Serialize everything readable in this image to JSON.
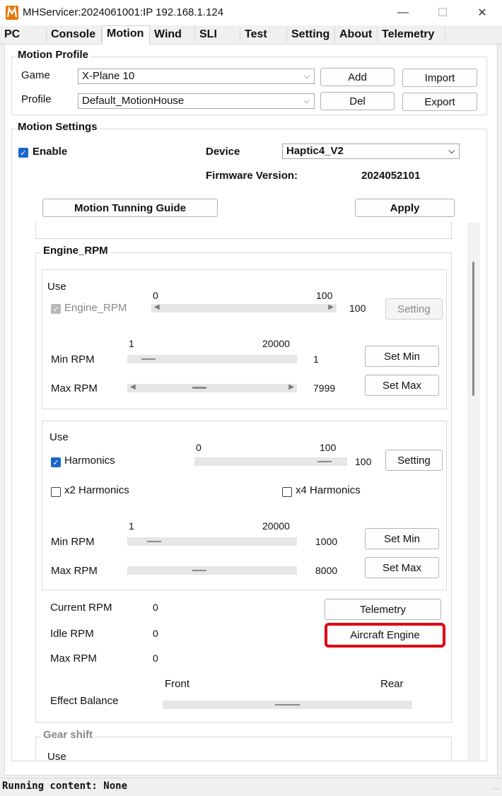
{
  "window": {
    "title": "MHServicer:2024061001:IP 192.168.1.124",
    "minimize_glyph": "—",
    "maximize_glyph": "☐",
    "close_glyph": "✕"
  },
  "tabs": [
    "PC",
    "Console",
    "Motion",
    "Wind",
    "SLI",
    "Test",
    "Setting",
    "About",
    "Telemetry"
  ],
  "active_tab": "Motion",
  "motion_profile": {
    "title": "Motion Profile",
    "game_label": "Game",
    "game_value": "X-Plane 10",
    "profile_label": "Profile",
    "profile_value": "Default_MotionHouse",
    "add_label": "Add",
    "import_label": "Import",
    "del_label": "Del",
    "export_label": "Export"
  },
  "motion_settings": {
    "title": "Motion Settings",
    "enable_label": "Enable",
    "enable_checked": true,
    "device_label": "Device",
    "device_value": "Haptic4_V2",
    "firmware_label": "Firmware Version:",
    "firmware_value": "2024052101",
    "guide_button": "Motion Tunning Guide",
    "apply_button": "Apply"
  },
  "engine_rpm": {
    "title": "Engine_RPM",
    "engine_box": {
      "use_label": "Use",
      "checkbox_label": "Engine_RPM",
      "scale_min": "0",
      "scale_max": "100",
      "value": "100",
      "level_fraction": 1.0,
      "setting_button": "Setting",
      "rpm_scale_min": "1",
      "rpm_scale_max": "20000",
      "min_rpm_label": "Min RPM",
      "min_rpm_value": "1",
      "set_min_button": "Set Min",
      "max_rpm_label": "Max RPM",
      "max_rpm_value": "7999",
      "set_max_button": "Set Max"
    },
    "harmonics_box": {
      "use_label": "Use",
      "checkbox_label": "Harmonics",
      "harmonics_checked": true,
      "scale_min": "0",
      "scale_max": "100",
      "value": "100",
      "setting_button": "Setting",
      "x2_label": "x2 Harmonics",
      "x4_label": "x4 Harmonics",
      "rpm_scale_min": "1",
      "rpm_scale_max": "20000",
      "min_rpm_label": "Min RPM",
      "min_rpm_value": "1000",
      "set_min_button": "Set Min",
      "max_rpm_label": "Max RPM",
      "max_rpm_value": "8000",
      "set_max_button": "Set Max"
    },
    "current_rpm_label": "Current RPM",
    "current_rpm_value": "0",
    "idle_rpm_label": "Idle RPM",
    "idle_rpm_value": "0",
    "max_rpm_label": "Max RPM",
    "max_rpm_value": "0",
    "telemetry_button": "Telemetry",
    "aircraft_engine_button": "Aircraft Engine",
    "front_label": "Front",
    "rear_label": "Rear",
    "effect_balance_label": "Effect Balance"
  },
  "gear_shift": {
    "title": "Gear shift",
    "use_label": "Use"
  },
  "status": {
    "text": "Running content: None"
  },
  "colors": {
    "accent": "#1a66c8",
    "highlight": "#e00012",
    "logo_orange": "#e8780a"
  }
}
